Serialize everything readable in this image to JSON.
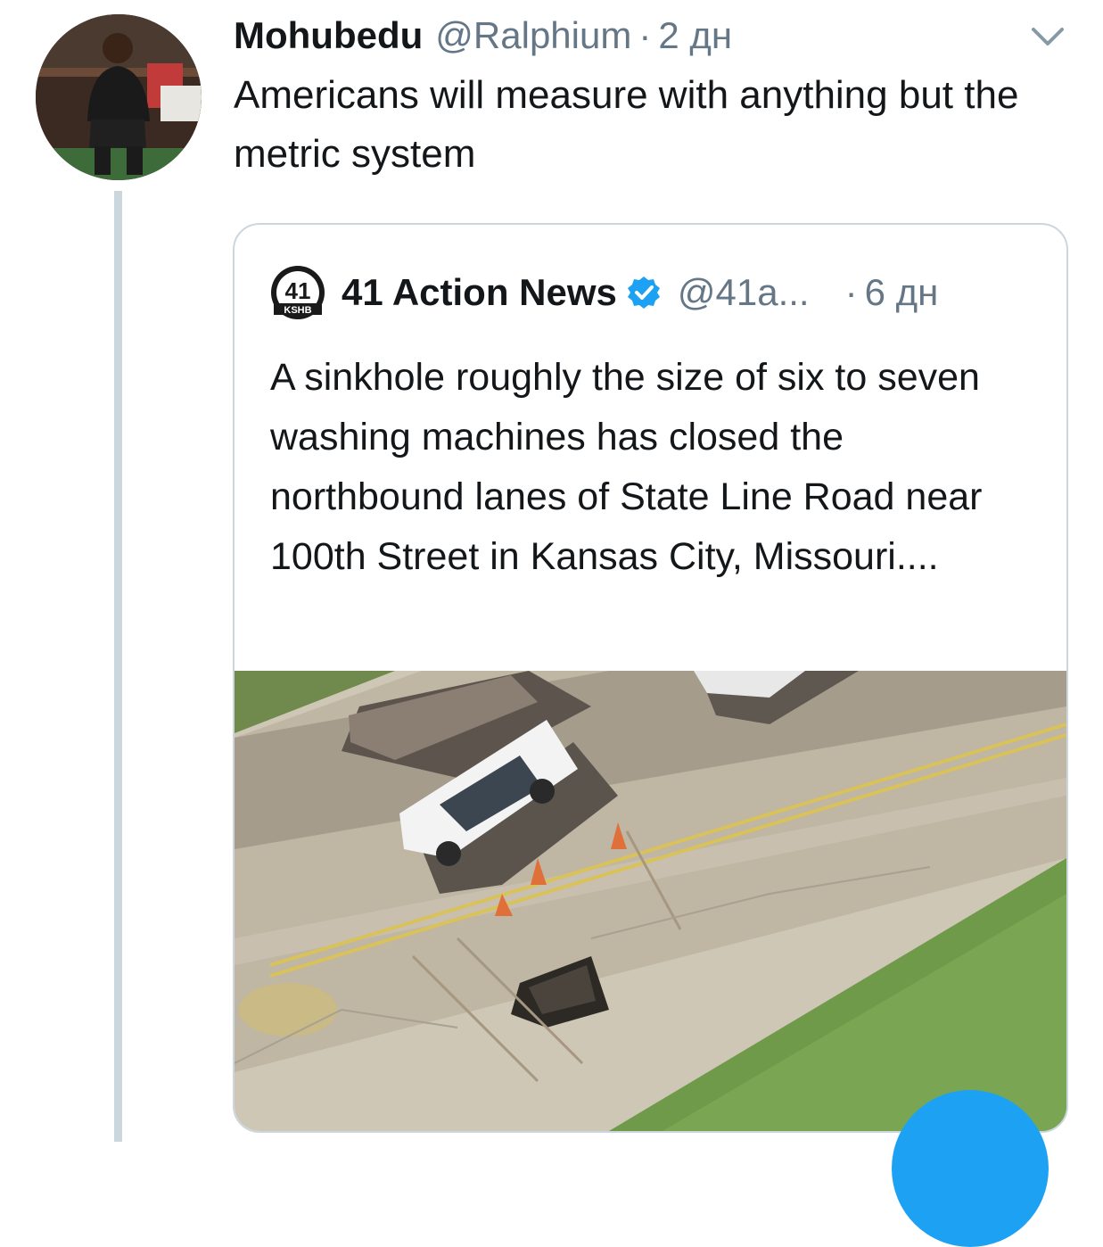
{
  "tweet": {
    "author_name": "Mohubedu",
    "author_handle": "@Ralphium",
    "separator": "·",
    "time": "2 дн",
    "text": "Americans will measure with anything but the metric system",
    "caret_icon": "chevron-down-icon"
  },
  "quoted_tweet": {
    "logo_number": "41",
    "logo_sub": "KSHB",
    "author_name": "41 Action News",
    "verified_icon": "verified-badge-icon",
    "author_handle": "@41a...",
    "separator": "·",
    "time": "6 дн",
    "text": "A sinkhole roughly the size of six to seven washing machines has closed the northbound lanes of State Line Road near 100th Street in Kansas City, Missouri...."
  },
  "colors": {
    "accent": "#1da1f2",
    "muted_text": "#657786",
    "border": "#ccd6dd"
  },
  "compose_button": {
    "icon": "compose-icon"
  }
}
